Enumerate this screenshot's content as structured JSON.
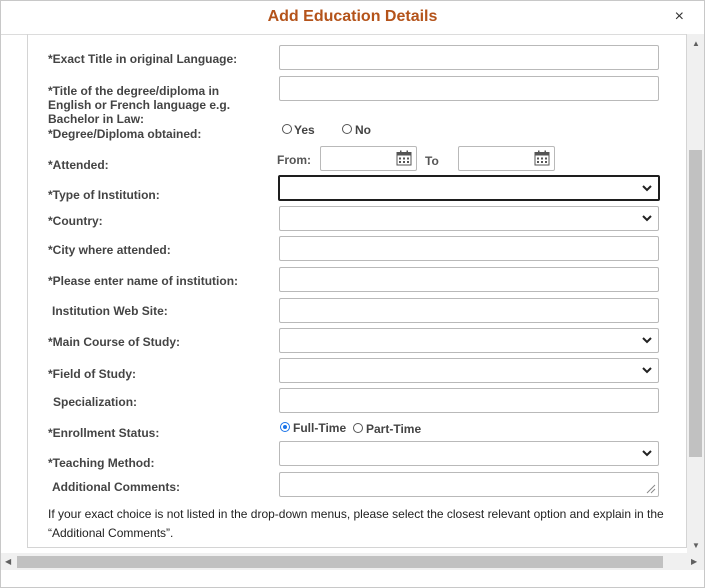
{
  "dialog": {
    "title": "Add Education Details",
    "close": "×"
  },
  "form": {
    "exact_title_label": "*Exact Title in original Language:",
    "degree_title_label": "*Title of the degree/diploma in English or French language e.g. Bachelor in Law:",
    "degree_obtained_label": "*Degree/Diploma obtained:",
    "yes_label": "Yes",
    "no_label": "No",
    "attended_label": "*Attended:",
    "from_label": "From:",
    "to_label": "To",
    "type_institution_label": "*Type of Institution:",
    "country_label": "*Country:",
    "city_label": "*City where attended:",
    "institution_name_label": "*Please enter name of institution:",
    "website_label": "Institution Web Site:",
    "main_course_label": "*Main Course of Study:",
    "field_study_label": "*Field of Study:",
    "specialization_label": "Specialization:",
    "enrollment_label": "*Enrollment Status:",
    "full_time_label": "Full-Time",
    "part_time_label": "Part-Time",
    "teaching_method_label": "*Teaching Method:",
    "comments_label": "Additional Comments:",
    "enrollment_selected": "Full-Time"
  },
  "note": "If your exact choice is not listed in the drop-down menus, please select the closest relevant option and explain in the “Additional Comments”.",
  "colors": {
    "title": "#b4531a",
    "radio_checked": "#1a73e8"
  },
  "icons": {
    "calendar": "calendar-icon",
    "chevron": "chevron-down-icon",
    "close": "close-icon"
  }
}
